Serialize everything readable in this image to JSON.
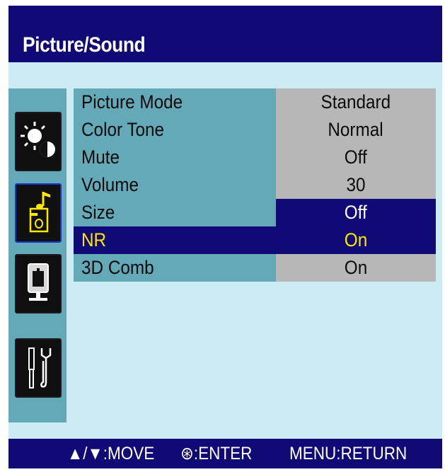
{
  "title": "Picture/Sound",
  "colors": {
    "header_bg": "#100a77",
    "panel_bg": "#cdebf2",
    "label_bg": "#64a9b7",
    "value_bg": "#b7b7b7",
    "highlight_text": "#ffe800"
  },
  "sidebar": {
    "icons": [
      {
        "name": "brightness-contrast-icon"
      },
      {
        "name": "sound-note-icon",
        "active": true
      },
      {
        "name": "tv-screen-icon"
      },
      {
        "name": "tools-setup-icon"
      }
    ]
  },
  "menu": {
    "items": [
      {
        "label": "Picture Mode",
        "value": "Standard"
      },
      {
        "label": "Color Tone",
        "value": "Normal"
      },
      {
        "label": "Mute",
        "value": "Off"
      },
      {
        "label": "Volume",
        "value": "30"
      },
      {
        "label": "Size",
        "value": "Off"
      },
      {
        "label": "NR",
        "value": "On",
        "selected": true
      },
      {
        "label": "3D Comb",
        "value": "On"
      }
    ]
  },
  "footer": {
    "move": "▲/▼:MOVE",
    "enter": "⊛:ENTER",
    "return": "MENU:RETURN"
  }
}
